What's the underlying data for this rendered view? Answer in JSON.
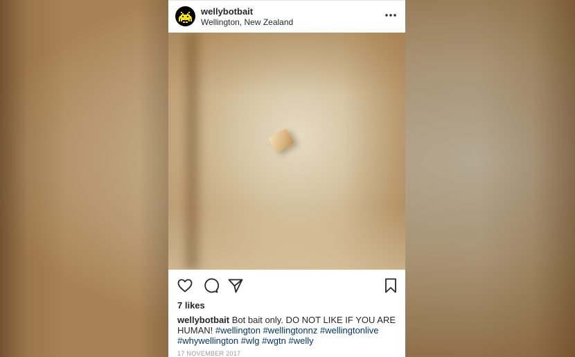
{
  "post": {
    "username": "wellybotbait",
    "location": "Wellington, New Zealand",
    "likes": "7 likes",
    "caption": {
      "username": "wellybotbait",
      "text": "Bot bait only. DO NOT LIKE IF YOU ARE HUMAN!",
      "hashtags": [
        "#wellington",
        "#wellingtonnz",
        "#wellingtonlive",
        "#whywellington",
        "#wlg",
        "#wgtn",
        "#welly"
      ]
    },
    "date": "17 NOVEMBER 2017"
  },
  "icons": {
    "avatar": "space-invader-icon",
    "more": "more-options-icon",
    "like": "heart-icon",
    "comment": "comment-icon",
    "share": "direct-share-icon",
    "save": "bookmark-icon"
  },
  "colors": {
    "avatar_fill": "#f5e600",
    "hashtag": "#003569"
  }
}
